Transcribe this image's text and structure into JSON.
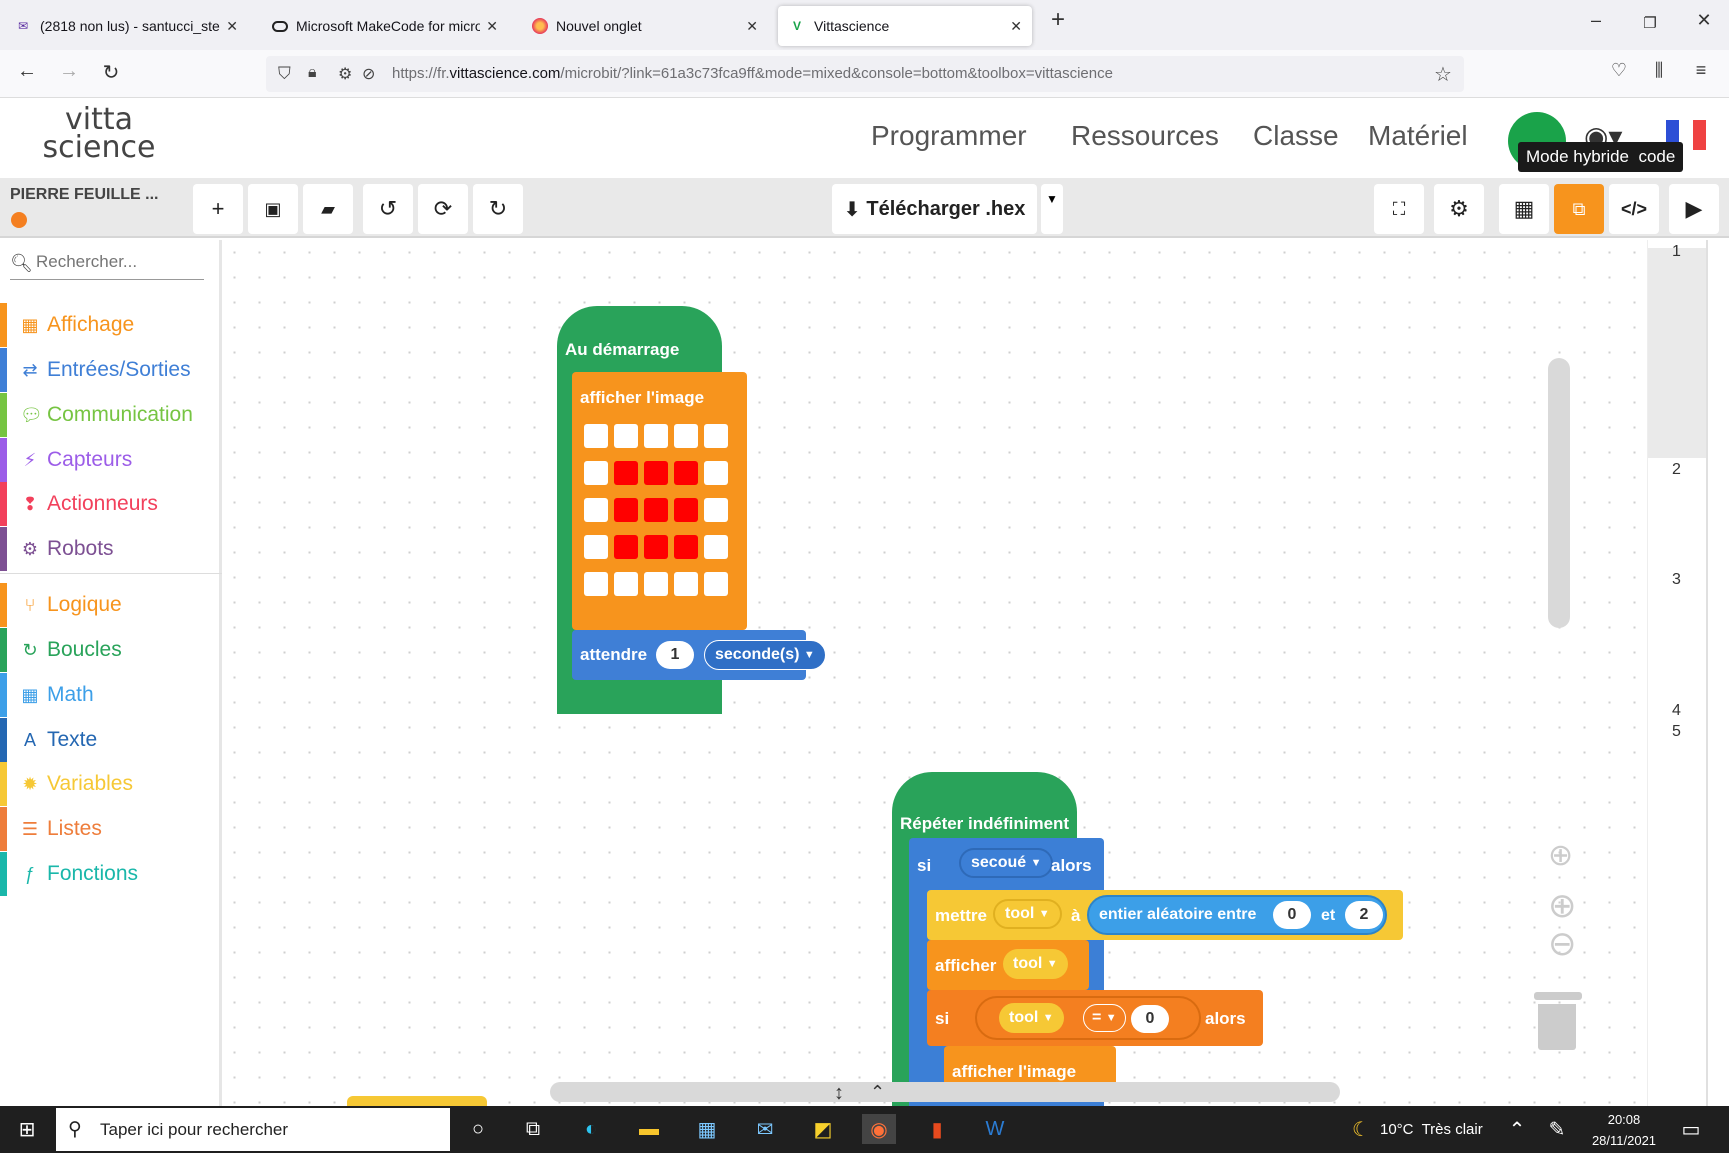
{
  "browser": {
    "tabs": [
      {
        "title": "(2818 non lus) - santucci_steph",
        "active": false
      },
      {
        "title": "Microsoft MakeCode for micro:",
        "active": false
      },
      {
        "title": "Nouvel onglet",
        "active": false
      },
      {
        "title": "Vittascience",
        "active": true
      }
    ],
    "url_prefix": "https://fr.",
    "url_domain": "vittascience.com",
    "url_path": "/microbit/?link=61a3c73fca9ff&mode=mixed&console=bottom&toolbox=vittascience"
  },
  "site": {
    "logo_line1": "vitta",
    "logo_line2": "science",
    "menu": [
      "Programmer",
      "Ressources",
      "Classe",
      "Matériel"
    ],
    "tooltip": "Mode hybride",
    "tooltip_extra": "code"
  },
  "toolbar": {
    "project_name": "PIERRE FEUILLE ...",
    "download_label": "Télécharger .hex"
  },
  "toolbox": {
    "search_placeholder": "Rechercher...",
    "categories": [
      {
        "label": "Affichage",
        "color": "#f7941d"
      },
      {
        "label": "Entrées/Sorties",
        "color": "#3f7fd6"
      },
      {
        "label": "Communication",
        "color": "#76c442"
      },
      {
        "label": "Capteurs",
        "color": "#9c5de8"
      },
      {
        "label": "Actionneurs",
        "color": "#f2405b"
      },
      {
        "label": "Robots",
        "color": "#7d5093"
      },
      {
        "label": "Logique",
        "color": "#f7941d"
      },
      {
        "label": "Boucles",
        "color": "#29a35a"
      },
      {
        "label": "Math",
        "color": "#3c9fe8"
      },
      {
        "label": "Texte",
        "color": "#2467b2"
      },
      {
        "label": "Variables",
        "color": "#f6c835"
      },
      {
        "label": "Listes",
        "color": "#ee7d3b"
      },
      {
        "label": "Fonctions",
        "color": "#1ab7aa"
      }
    ]
  },
  "blocks": {
    "start": {
      "hat": "Au démarrage",
      "show_image": "afficher l'image",
      "leds": [
        [
          0,
          0,
          0,
          0,
          0
        ],
        [
          0,
          1,
          1,
          1,
          0
        ],
        [
          0,
          1,
          1,
          1,
          0
        ],
        [
          0,
          1,
          1,
          1,
          0
        ],
        [
          0,
          0,
          0,
          0,
          0
        ]
      ],
      "wait_label": "attendre",
      "wait_value": "1",
      "wait_unit": "seconde(s)"
    },
    "forever": {
      "hat": "Répéter indéfiniment",
      "if1": "si",
      "shaken": "secoué",
      "then": "alors",
      "set": "mettre",
      "var": "tool",
      "to": "à",
      "random": "entier aléatoire entre",
      "rand_min": "0",
      "and": "et",
      "rand_max": "2",
      "show": "afficher",
      "if2": "si",
      "eq": "=",
      "cmp_value": "0",
      "then2": "alors",
      "show_image2": "afficher l'image"
    }
  },
  "code": {
    "line_numbers": [
      "1",
      "2",
      "3",
      "4",
      "5"
    ]
  },
  "taskbar": {
    "search_placeholder": "Taper ici pour rechercher",
    "weather": "10°C  Très clair",
    "time": "20:08",
    "date": "28/11/2021"
  }
}
